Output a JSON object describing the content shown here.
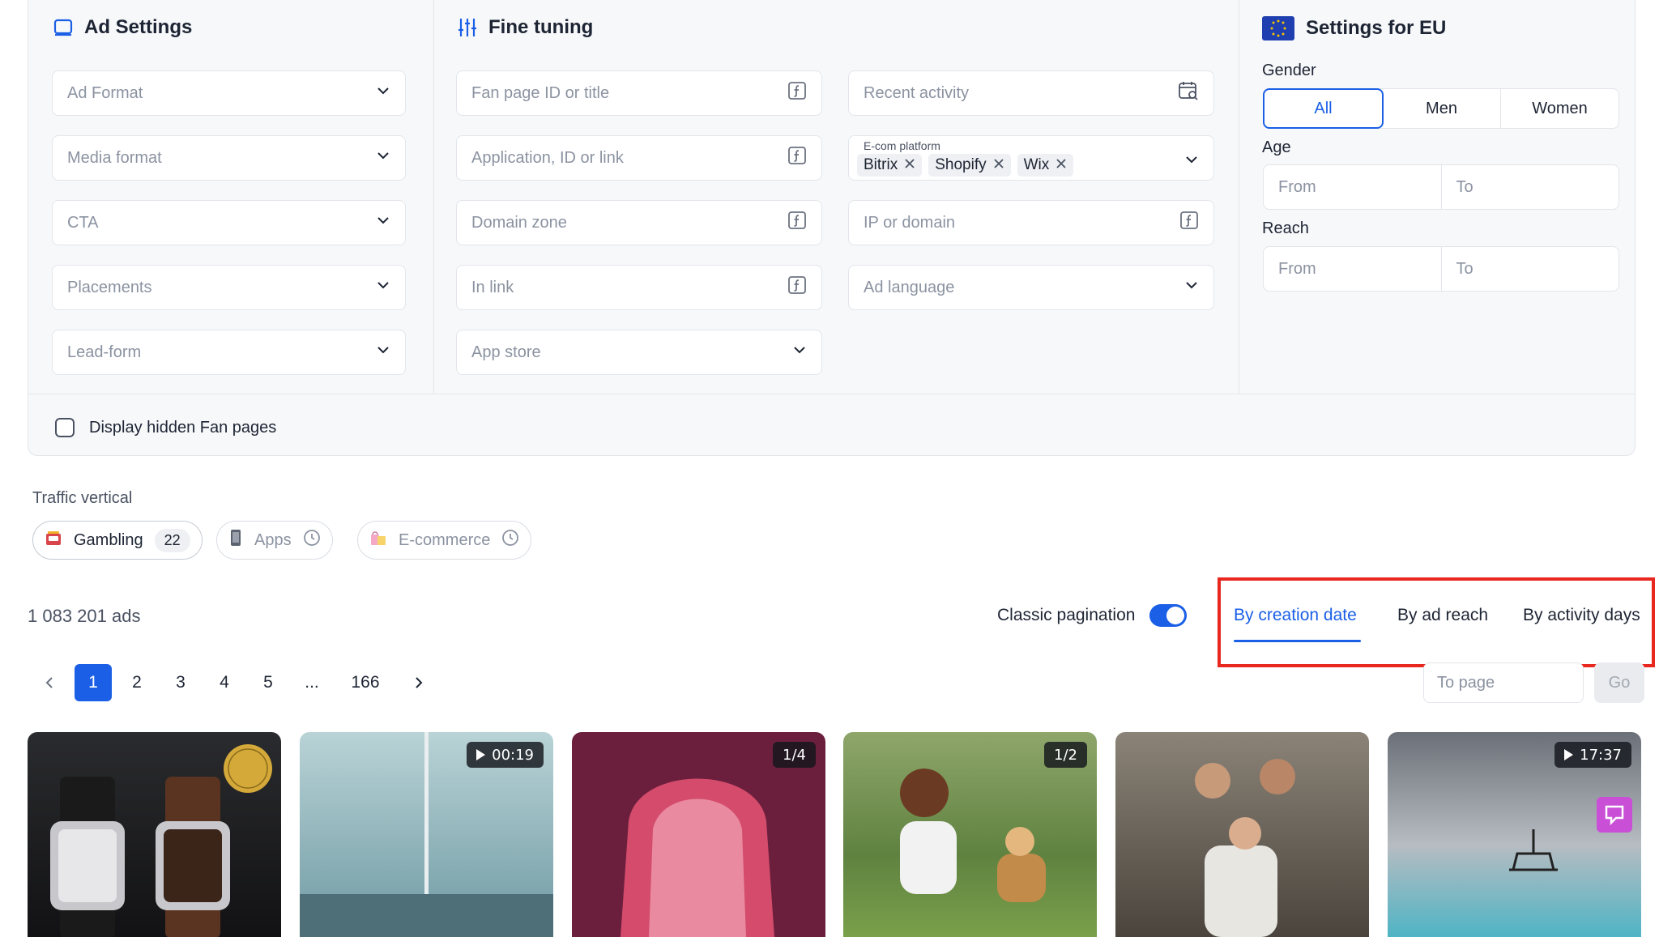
{
  "ad_settings": {
    "title": "Ad Settings",
    "fields": [
      "Ad Format",
      "Media format",
      "CTA",
      "Placements",
      "Lead-form"
    ]
  },
  "fine_tuning": {
    "title": "Fine tuning",
    "left_fields": [
      "Fan page ID or title",
      "Application, ID or link",
      "Domain zone",
      "In link",
      "App store"
    ],
    "recent_activity": "Recent activity",
    "ecom_label": "E-com platform",
    "ecom_tags": [
      "Bitrix",
      "Shopify",
      "Wix"
    ],
    "ip_domain": "IP or domain",
    "ad_language": "Ad language"
  },
  "eu": {
    "title": "Settings for EU",
    "gender_label": "Gender",
    "gender_options": [
      "All",
      "Men",
      "Women"
    ],
    "gender_selected": "All",
    "age_label": "Age",
    "reach_label": "Reach",
    "from": "From",
    "to": "To"
  },
  "hidden_fanpages_label": "Display hidden Fan pages",
  "traffic_vertical": {
    "label": "Traffic vertical",
    "chips": [
      {
        "label": "Gambling",
        "count": "22"
      },
      {
        "label": "Apps"
      },
      {
        "label": "E-commerce"
      }
    ]
  },
  "results": {
    "ads_count": "1 083 201 ads",
    "classic_pagination": "Classic pagination",
    "classic_pagination_on": true,
    "sort_tabs": [
      "By creation date",
      "By ad reach",
      "By activity days"
    ],
    "sort_selected": "By creation date"
  },
  "pagination": {
    "pages": [
      "1",
      "2",
      "3",
      "4",
      "5",
      "...",
      "166"
    ],
    "current": "1",
    "to_page_placeholder": "To page",
    "go_label": "Go"
  },
  "cards": [
    {
      "badge": ""
    },
    {
      "badge": "00:19",
      "video": true
    },
    {
      "badge": "1/4"
    },
    {
      "badge": "1/2"
    },
    {
      "badge": ""
    },
    {
      "badge": "17:37",
      "video": true
    }
  ],
  "colors": {
    "accent": "#1a5fe6",
    "highlight_box": "#e8281e"
  }
}
